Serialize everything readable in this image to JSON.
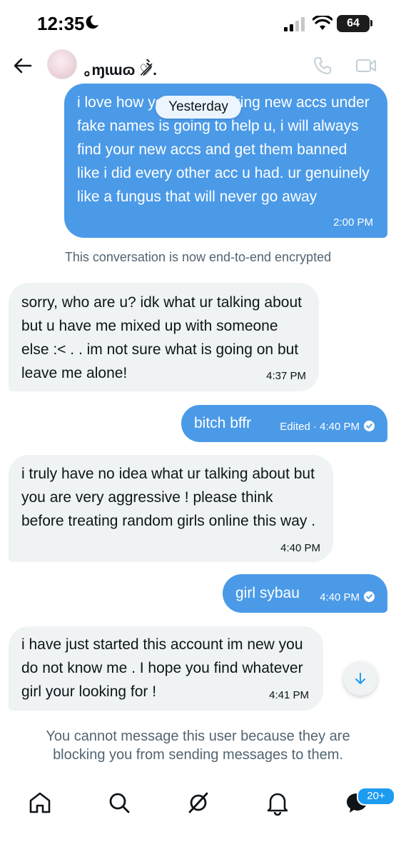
{
  "status_bar": {
    "time": "12:35",
    "battery": "64"
  },
  "header": {
    "contact_name": "｡ɱɩɯɷ ♡̷̸̷̷̀̀."
  },
  "date_separator": "Yesterday",
  "messages": [
    {
      "direction": "out",
      "text": "i love how you think making new accs under fake names is going to help u, i will always find your new accs and get them banned like i did every other acc u had. ur genuinely like a fungus that will never go away",
      "time": "2:00 PM"
    },
    {
      "direction": "in",
      "text": "sorry, who are u? idk what ur talking about but u have me mixed up with someone else :< . . im not sure what is going on but leave me alone!",
      "time": "4:37 PM"
    },
    {
      "direction": "out",
      "text": "bitch bffr",
      "time": "Edited · 4:40 PM"
    },
    {
      "direction": "in",
      "text": "i truly have no idea what ur talking about but you are very aggressive ! please think before treating random girls online this way .",
      "time": "4:40 PM"
    },
    {
      "direction": "out",
      "text": "girl sybau",
      "time": "4:40 PM"
    },
    {
      "direction": "in",
      "text": "i have just started this account im new you do not know me . I hope you find whatever girl your looking for !",
      "time": "4:41 PM"
    }
  ],
  "encryption_notice": "This conversation is now end-to-end encrypted",
  "blocked_notice": "You cannot message this user because they are blocking you from sending messages to them.",
  "tabbar": {
    "items": [
      "home-icon",
      "search-icon",
      "grok-icon",
      "notifications-icon",
      "messages-icon"
    ],
    "badge": "20+"
  },
  "colors": {
    "outgoing": "#4b9ae8",
    "incoming": "#eff3f4",
    "muted": "#536471",
    "accent": "#1d9bf0"
  }
}
